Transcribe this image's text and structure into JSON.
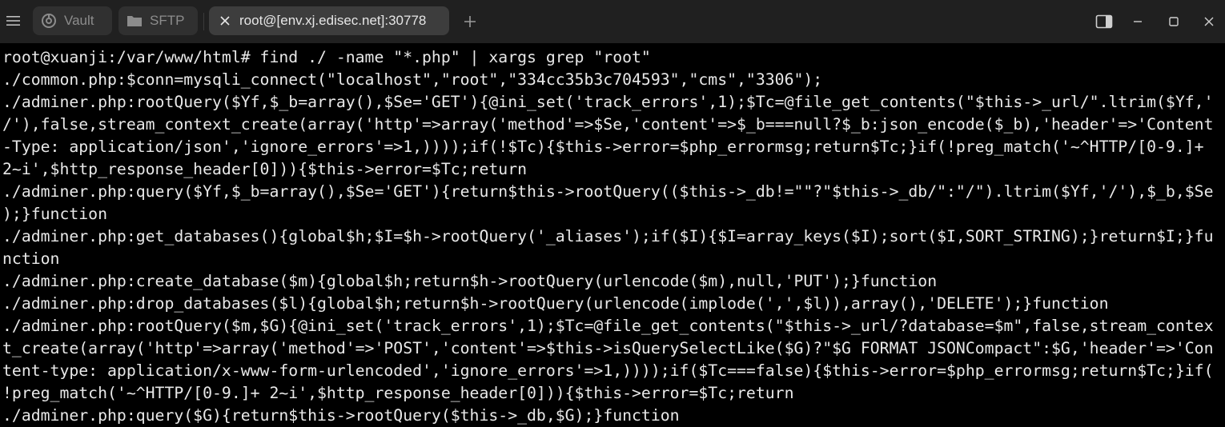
{
  "tabs": [
    {
      "label": "Vault",
      "icon": "vault-icon"
    },
    {
      "label": "SFTP",
      "icon": "folder-icon"
    },
    {
      "label": "root@[env.xj.edisec.net]:30778",
      "icon": "close-icon",
      "active": true
    }
  ],
  "colors": {
    "titlebar_bg": "#202020",
    "tab_bg": "#303030",
    "active_tab_bg": "#3d3d3d",
    "terminal_bg": "#000000",
    "terminal_fg": "#e8e8e8"
  },
  "terminal": {
    "lines": [
      "root@xuanji:/var/www/html# find ./ -name \"*.php\" | xargs grep \"root\"",
      "./common.php:$conn=mysqli_connect(\"localhost\",\"root\",\"334cc35b3c704593\",\"cms\",\"3306\");",
      "./adminer.php:rootQuery($Yf,$_b=array(),$Se='GET'){@ini_set('track_errors',1);$Tc=@file_get_contents(\"$this->_url/\".ltrim($Yf,'",
      "/'),false,stream_context_create(array('http'=>array('method'=>$Se,'content'=>$_b===null?$_b:json_encode($_b),'header'=>'Content",
      "-Type: application/json','ignore_errors'=>1,))));if(!$Tc){$this->error=$php_errormsg;return$Tc;}if(!preg_match('~^HTTP/[0-9.]+",
      "2~i',$http_response_header[0])){$this->error=$Tc;return",
      "./adminer.php:query($Yf,$_b=array(),$Se='GET'){return$this->rootQuery(($this->_db!=\"\"?\"$this->_db/\":\"/\").ltrim($Yf,'/'),$_b,$Se",
      ");}function",
      "./adminer.php:get_databases(){global$h;$I=$h->rootQuery('_aliases');if($I){$I=array_keys($I);sort($I,SORT_STRING);}return$I;}fu",
      "nction",
      "./adminer.php:create_database($m){global$h;return$h->rootQuery(urlencode($m),null,'PUT');}function",
      "./adminer.php:drop_databases($l){global$h;return$h->rootQuery(urlencode(implode(',',$l)),array(),'DELETE');}function",
      "./adminer.php:rootQuery($m,$G){@ini_set('track_errors',1);$Tc=@file_get_contents(\"$this->_url/?database=$m\",false,stream_contex",
      "t_create(array('http'=>array('method'=>'POST','content'=>$this->isQuerySelectLike($G)?\"$G FORMAT JSONCompact\":$G,'header'=>'Con",
      "tent-type: application/x-www-form-urlencoded','ignore_errors'=>1,))));if($Tc===false){$this->error=$php_errormsg;return$Tc;}if(",
      "!preg_match('~^HTTP/[0-9.]+ 2~i',$http_response_header[0])){$this->error=$Tc;return",
      "./adminer.php:query($G){return$this->rootQuery($this->_db,$G);}function"
    ]
  }
}
